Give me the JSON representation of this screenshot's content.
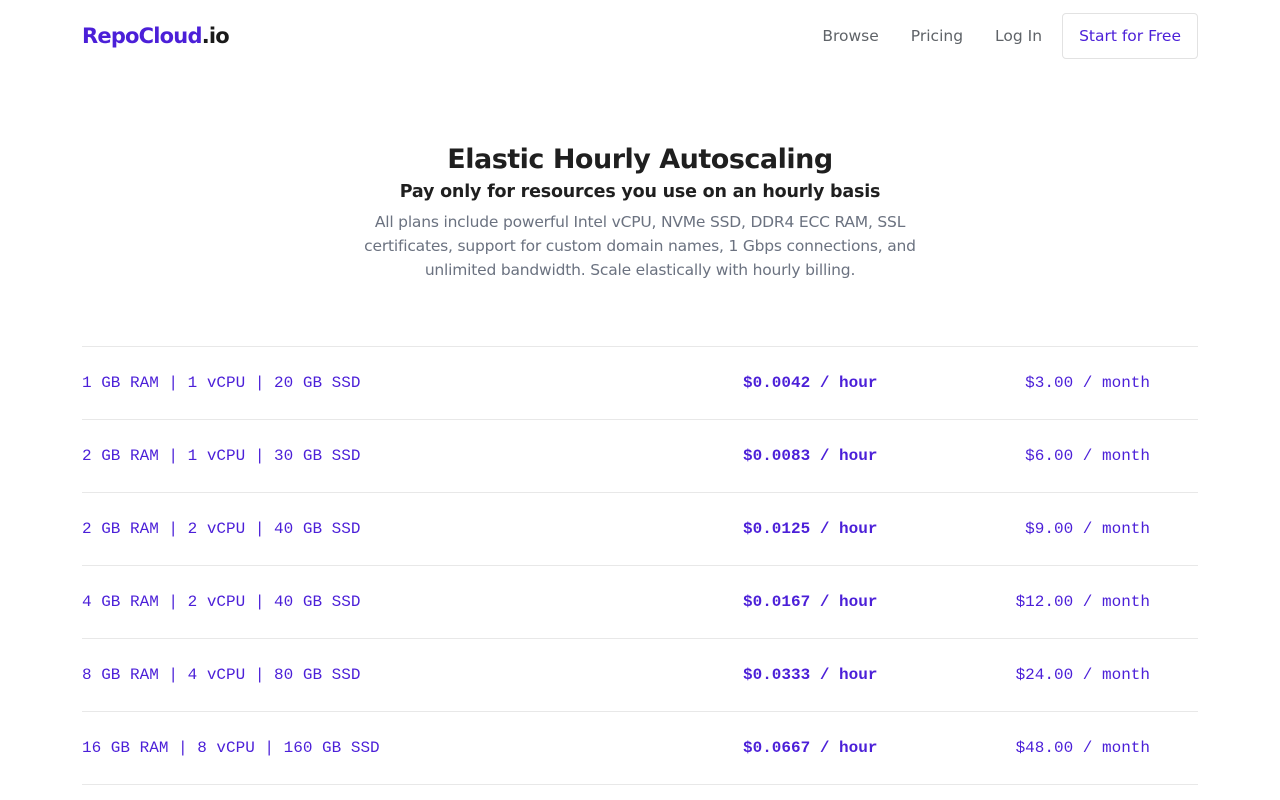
{
  "brand": {
    "name": "RepoCloud",
    "tld": ".io",
    "primary_color": "#4b1fd8"
  },
  "nav": {
    "links": [
      "Browse",
      "Pricing",
      "Log In"
    ],
    "cta_label": "Start for Free"
  },
  "hero": {
    "title": "Elastic Hourly Autoscaling",
    "subtitle": "Pay only for resources you use on an hourly basis",
    "description": "All plans include powerful Intel vCPU, NVMe SSD, DDR4 ECC RAM, SSL certificates, support for custom domain names, 1 Gbps connections, and unlimited bandwidth. Scale elastically with hourly billing."
  },
  "plans": [
    {
      "spec": "1 GB RAM | 1 vCPU | 20 GB SSD",
      "hourly": "$0.0042 / hour",
      "monthly": "$3.00 / month"
    },
    {
      "spec": "2 GB RAM | 1 vCPU | 30 GB SSD",
      "hourly": "$0.0083 / hour",
      "monthly": "$6.00 / month"
    },
    {
      "spec": "2 GB RAM | 2 vCPU | 40 GB SSD",
      "hourly": "$0.0125 / hour",
      "monthly": "$9.00 / month"
    },
    {
      "spec": "4 GB RAM | 2 vCPU | 40 GB SSD",
      "hourly": "$0.0167 / hour",
      "monthly": "$12.00 / month"
    },
    {
      "spec": "8 GB RAM | 4 vCPU | 80 GB SSD",
      "hourly": "$0.0333 / hour",
      "monthly": "$24.00 / month"
    },
    {
      "spec": "16 GB RAM | 8 vCPU | 160 GB SSD",
      "hourly": "$0.0667 / hour",
      "monthly": "$48.00 / month"
    }
  ]
}
